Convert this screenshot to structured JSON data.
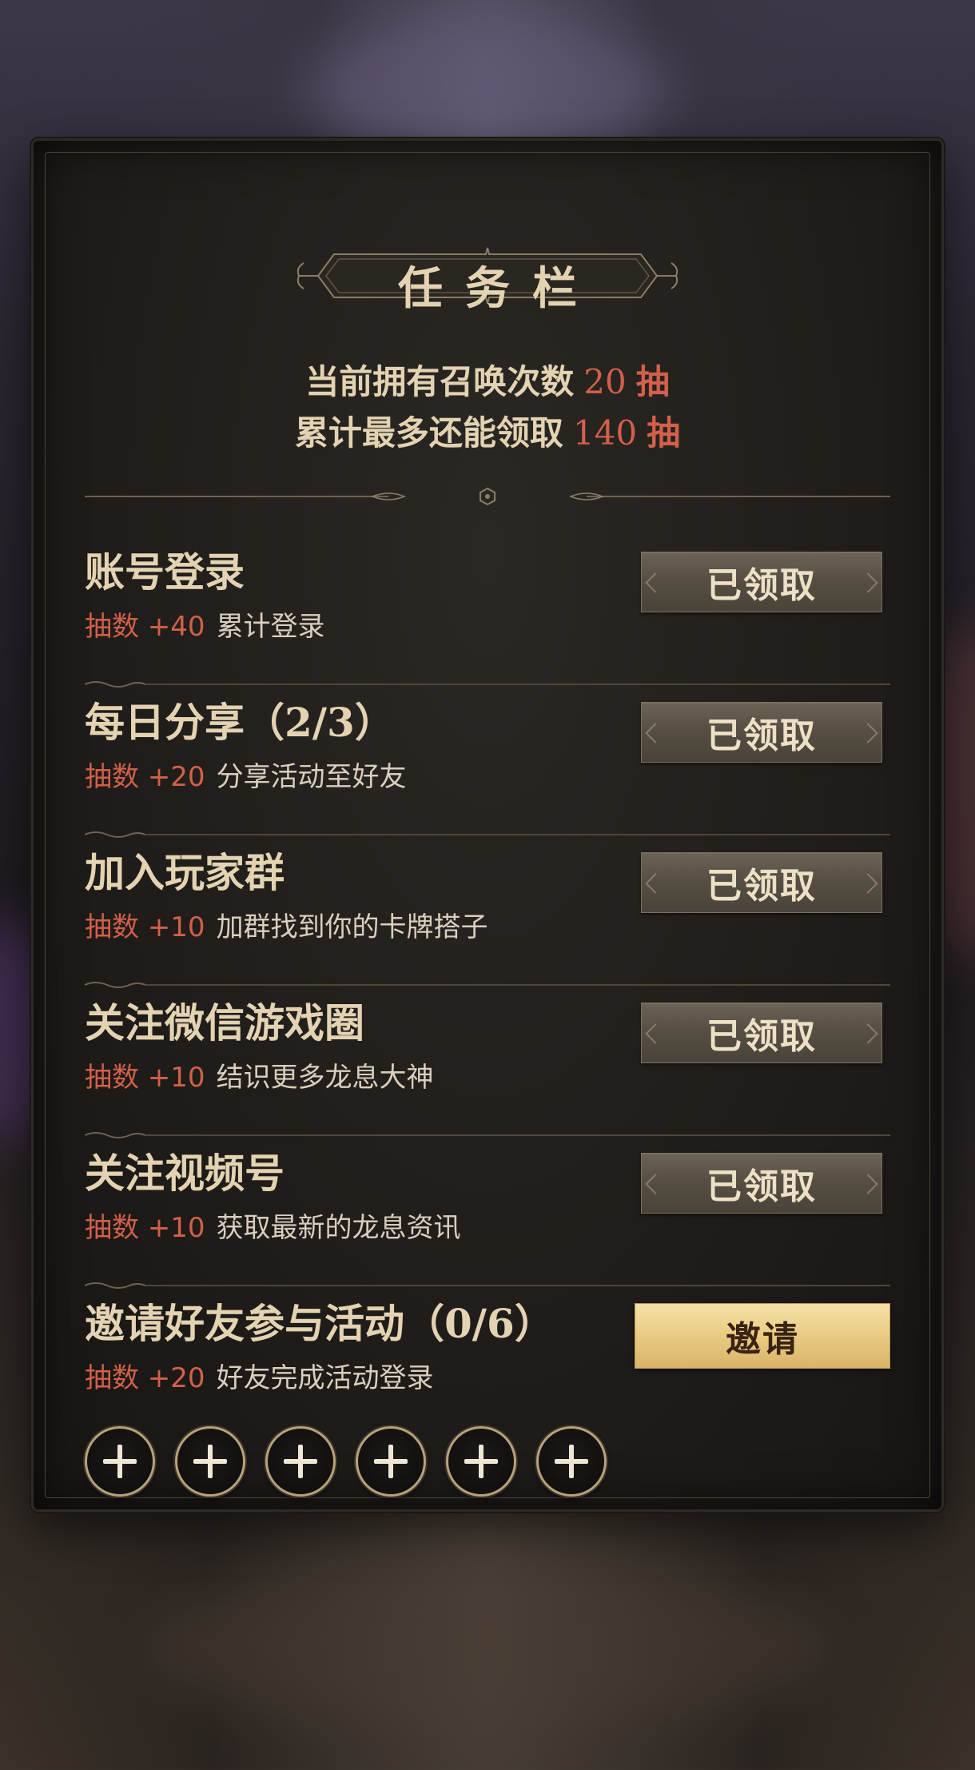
{
  "panel": {
    "title": "任务栏",
    "stats": [
      {
        "label": "当前拥有召唤次数",
        "value": "20",
        "unit": "抽"
      },
      {
        "label": "累计最多还能领取",
        "value": "140",
        "unit": "抽"
      }
    ]
  },
  "tasks": [
    {
      "title": "账号登录",
      "reward": "抽数 +40",
      "desc": "累计登录",
      "button": "已领取"
    },
    {
      "title": "每日分享（2/3）",
      "reward": "抽数 +20",
      "desc": "分享活动至好友",
      "button": "已领取"
    },
    {
      "title": "加入玩家群",
      "reward": "抽数 +10",
      "desc": "加群找到你的卡牌搭子",
      "button": "已领取"
    },
    {
      "title": "关注微信游戏圈",
      "reward": "抽数 +10",
      "desc": "结识更多龙息大神",
      "button": "已领取"
    },
    {
      "title": "关注视频号",
      "reward": "抽数 +10",
      "desc": "获取最新的龙息资讯",
      "button": "已领取"
    }
  ],
  "invite": {
    "title": "邀请好友参与活动（0/6）",
    "reward": "抽数 +20",
    "desc": "好友完成活动登录",
    "button": "邀请",
    "slots_total": 6,
    "slots_filled": 0
  },
  "colors": {
    "accent_red": "#d2604a",
    "text_gold": "#e3d3b2",
    "invite_gold": "#e9cb82"
  }
}
